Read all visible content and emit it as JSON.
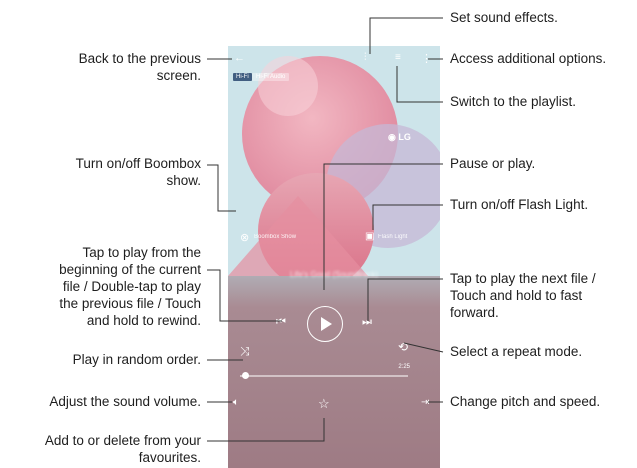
{
  "callouts": {
    "back": [
      "Back to the previous",
      "screen."
    ],
    "boombox": [
      "Turn on/off Boombox",
      "show."
    ],
    "prev": [
      "Tap to play from the",
      "beginning of the current",
      "file / Double-tap to play",
      "the previous file / Touch",
      "and hold to rewind."
    ],
    "shuffle": [
      "Play in random order."
    ],
    "volume": [
      "Adjust the sound volume."
    ],
    "favourite": [
      "Add to or delete from your",
      "favourites."
    ],
    "sound_effects": [
      "Set sound effects."
    ],
    "more_options": [
      "Access additional options."
    ],
    "playlist": [
      "Switch to the playlist."
    ],
    "pause_play": [
      "Pause or play."
    ],
    "flash": [
      "Turn on/off Flash Light."
    ],
    "next": [
      "Tap to play the next file /",
      "Touch and hold to fast",
      "forward."
    ],
    "repeat": [
      "Select a repeat mode."
    ],
    "pitch": [
      "Change pitch and speed."
    ]
  },
  "phone": {
    "hifi_badge": "Hi-Fi",
    "quality_chip": "Hi-Fi Audio",
    "brand": "LG",
    "boombox_label": "Boombox Show",
    "flash_label": "Flash Light",
    "track_title": "Life's Good (Soundtrack)",
    "elapsed_time": "2:25",
    "progress_fraction": 0.03
  },
  "colors": {
    "art_blue": "#c9e2ea",
    "art_pink": "#e9a3b2",
    "art_mauve": "#9e7b84",
    "line": "#333333"
  }
}
